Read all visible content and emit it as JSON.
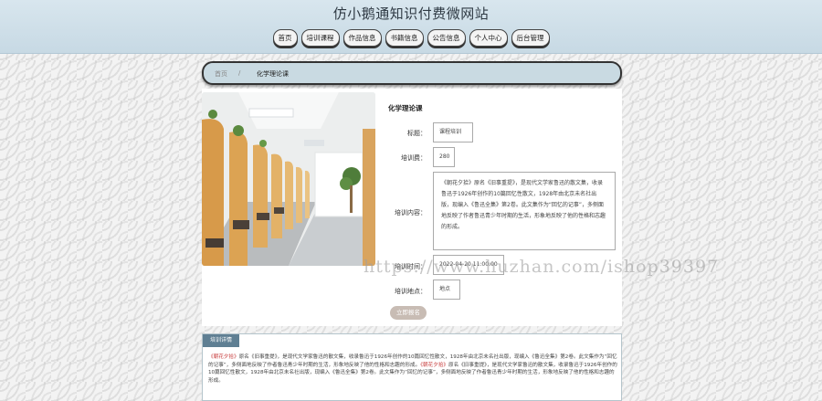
{
  "site": {
    "title": "仿小鹅通知识付费微网站"
  },
  "nav": {
    "items": [
      "首页",
      "培训课程",
      "作品信息",
      "书籍信息",
      "公告信息",
      "个人中心",
      "后台管理"
    ]
  },
  "breadcrumb": {
    "home": "首页",
    "separator": "/",
    "current": "化学理论课"
  },
  "course": {
    "title": "化学理论课",
    "fields": {
      "label_title": "标题：",
      "label_fee": "培训费：",
      "label_content": "培训内容：",
      "label_time": "培训时间：",
      "label_place": "培训地点：",
      "value_title": "课程培训",
      "value_fee": "280",
      "value_content": "《朝花夕拾》原名《旧事重提》，是现代文学家鲁迅的散文集，收录鲁迅于1926年创作的10篇回忆性散文，1928年由北京未名社出版，现编入《鲁迅全集》第2卷。此文集作为“回忆的记事”，多侧面地反映了作者鲁迅青少年时期的生活，形象地反映了他的性格和志趣的形成。",
      "value_time": "2022-04-20 11:00:00",
      "value_place": "地点"
    },
    "enroll_label": "立即报名"
  },
  "detail": {
    "tab_label": "培训详情",
    "p1_accent": "《朝花夕拾》",
    "p1_text": "原名《旧事重提》，是现代文学家鲁迅的散文集，收录鲁迅于1926年创作的10篇回忆性散文，1928年由北京未名社出版，现编入《鲁迅全集》第2卷。此文集作为“回忆的记事”，多侧面地反映了作者鲁迅青少年时期的生活，形象地反映了他的性格和志趣的形成。",
    "p2_accent": "《朝花夕拾》",
    "p2_text": "原名《旧事重提》，是现代文学家鲁迅的散文集，收录鲁迅于1926年创作的10篇回忆性散文，1928年由北京未名社出版，现编入《鲁迅全集》第2卷。此文集作为“回忆的记事”，多侧面地反映了作者鲁迅青少年时期的生活，形象地反映了他的性格和志趣的形成。"
  },
  "watermark": "https://www.huzhan.com/ishop39397",
  "colors": {
    "accent": "#c73a3a",
    "tab": "#5f7f93",
    "breadcrumb_bg": "#c9dae2"
  }
}
